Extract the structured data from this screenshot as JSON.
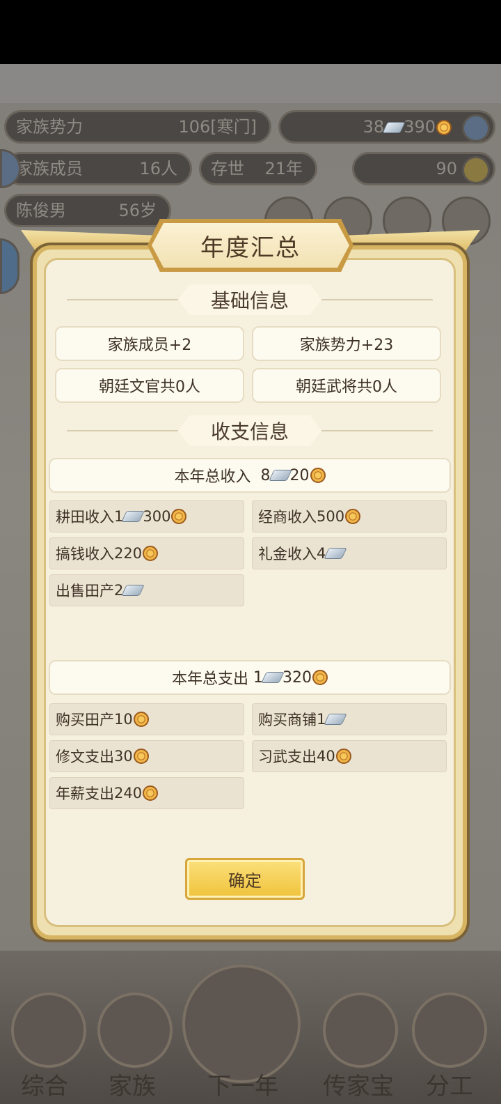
{
  "background": {
    "family_power_label": "家族势力",
    "family_power_value": "106[寒门]",
    "silver_count": "38",
    "copper_count": "390",
    "family_members_label": "家族成员",
    "family_members_value": "16人",
    "existence_label": "存世",
    "existence_value": "21年",
    "gold_value": "90",
    "person_name": "陈俊男",
    "person_age": "56岁",
    "nav": {
      "tab1": "综合",
      "tab2": "家族",
      "tab3": "下一年",
      "tab4": "传家宝",
      "tab5": "分工"
    }
  },
  "modal": {
    "title": "年度汇总",
    "basic_info_header": "基础信息",
    "basic_cards": [
      "家族成员+2",
      "家族势力+23",
      "朝廷文官共0人",
      "朝廷武将共0人"
    ],
    "finance_header": "收支信息",
    "income_total_label": "本年总收入",
    "income_total_silver": "8",
    "income_total_copper": "20",
    "income_items": [
      {
        "label": "耕田收入",
        "silver": "1",
        "copper": "300"
      },
      {
        "label": "经商收入",
        "copper": "500"
      },
      {
        "label": "搞钱收入",
        "copper": "220"
      },
      {
        "label": "礼金收入",
        "silver": "4"
      },
      {
        "label": "出售田产",
        "silver": "2"
      }
    ],
    "expense_total_label": "本年总支出",
    "expense_total_silver": "1",
    "expense_total_copper": "320",
    "expense_items": [
      {
        "label": "购买田产",
        "copper": "10"
      },
      {
        "label": "购买商铺",
        "silver": "1"
      },
      {
        "label": "修文支出",
        "copper": "30"
      },
      {
        "label": "习武支出",
        "copper": "40"
      },
      {
        "label": "年薪支出",
        "copper": "240"
      }
    ],
    "confirm_label": "确定"
  },
  "colors": {
    "accent_gold": "#f0c23a",
    "panel_bg": "#f6f0df",
    "frame": "#d6b462"
  }
}
